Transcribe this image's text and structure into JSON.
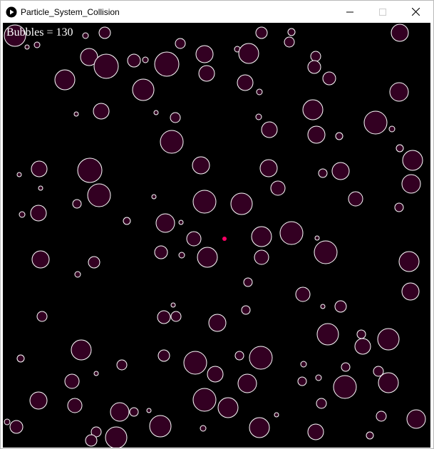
{
  "window": {
    "title": "Particle_System_Collision",
    "app_icon": "play-icon",
    "minimize_icon": "minimize-icon",
    "maximize_icon": "maximize-icon",
    "close_icon": "close-icon"
  },
  "canvas": {
    "background": "#000000",
    "counter_text": "Bubbles = 130",
    "bubble_fill": "#330022",
    "bubble_stroke": "#ffffff",
    "cursor_dot_color": "#ff0066"
  }
}
